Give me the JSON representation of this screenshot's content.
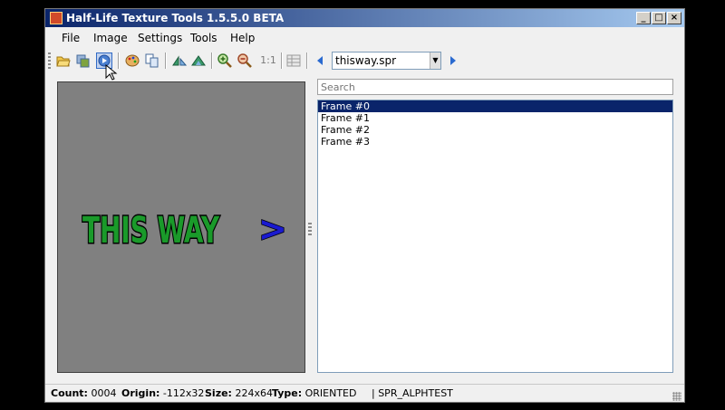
{
  "window": {
    "title": "Half-Life Texture Tools 1.5.5.0 BETA"
  },
  "menu": [
    "File",
    "Image",
    "Settings",
    "Tools",
    "Help"
  ],
  "toolbar": {
    "zoom_reset_label": "1:1",
    "file_combo": "thisway.spr"
  },
  "search": {
    "placeholder": "Search"
  },
  "frames": [
    "Frame #0",
    "Frame #1",
    "Frame #2",
    "Frame #3"
  ],
  "preview": {
    "text": "THIS WAY",
    "arrow": ">"
  },
  "status": {
    "count_label": "Count:",
    "count_value": "0004",
    "origin_label": "Origin:",
    "origin_value": "-112x32",
    "size_label": "Size:",
    "size_value": "224x64",
    "type_label": "Type:",
    "type_value": "ORIENTED",
    "format_value": "| SPR_ALPHTEST"
  }
}
